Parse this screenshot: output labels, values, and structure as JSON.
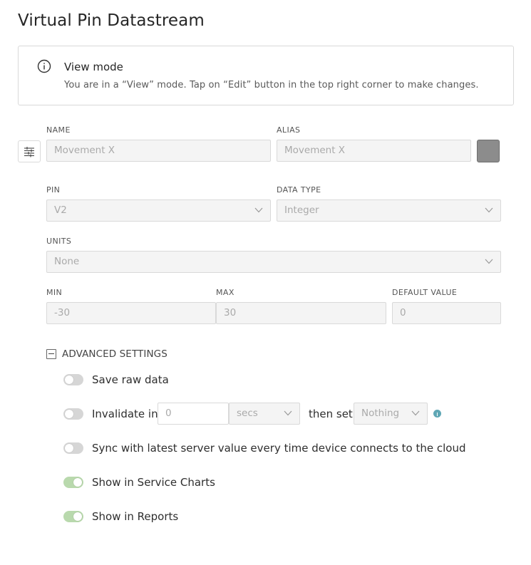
{
  "page": {
    "title": "Virtual Pin Datastream"
  },
  "notice": {
    "title": "View mode",
    "text": "You are in a “View” mode. Tap on “Edit” button in the top right corner to make changes."
  },
  "fields": {
    "name": {
      "label": "NAME",
      "value": "Movement  X"
    },
    "alias": {
      "label": "ALIAS",
      "value": "Movement  X"
    },
    "color": "#8c8c8c",
    "pin": {
      "label": "PIN",
      "value": "V2"
    },
    "data_type": {
      "label": "DATA TYPE",
      "value": "Integer"
    },
    "units": {
      "label": "UNITS",
      "value": "None"
    },
    "min": {
      "label": "MIN",
      "value": "-30"
    },
    "max": {
      "label": "MAX",
      "value": "30"
    },
    "default_value": {
      "label": "DEFAULT VALUE",
      "value": "0"
    }
  },
  "advanced": {
    "label": "ADVANCED SETTINGS",
    "save_raw": {
      "label": "Save raw data",
      "enabled": false
    },
    "invalidate": {
      "label": "Invalidate in",
      "amount": "0",
      "unit": "secs",
      "then_label": "then set",
      "then_value": "Nothing",
      "enabled": false
    },
    "sync": {
      "label": "Sync with latest server value every time device connects to the cloud",
      "enabled": false
    },
    "service_charts": {
      "label": "Show in Service Charts",
      "enabled": true
    },
    "reports": {
      "label": "Show in Reports",
      "enabled": true
    }
  },
  "colors": {
    "toggle_on": "#b9d9ad",
    "toggle_off": "#d6d6d6",
    "tooltip": "#5fa7b5"
  }
}
